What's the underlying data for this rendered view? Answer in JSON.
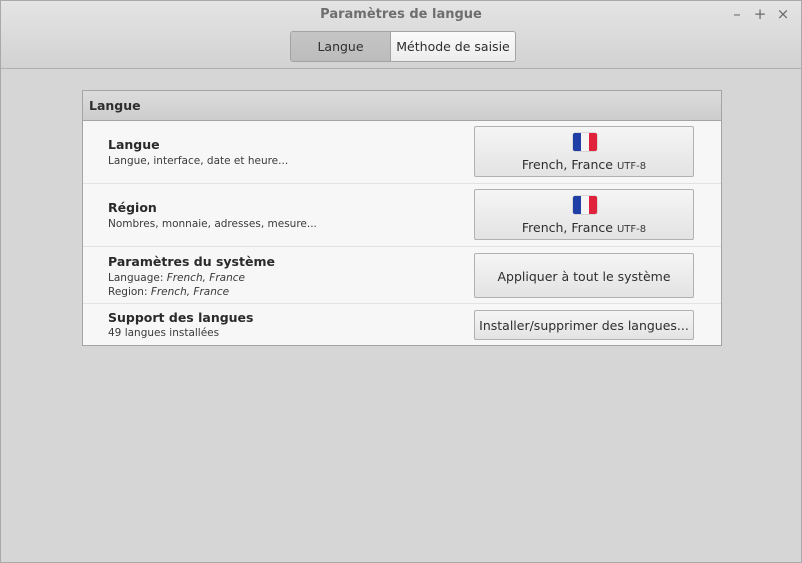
{
  "window": {
    "title": "Paramètres de langue",
    "controls": {
      "minimize": "–",
      "maximize": "+",
      "close": "×"
    }
  },
  "tabs": [
    {
      "label": "Langue",
      "active": true
    },
    {
      "label": "Méthode de saisie",
      "active": false
    }
  ],
  "panel": {
    "header": "Langue",
    "rows": [
      {
        "label": "Langue",
        "desc": "Langue, interface, date et heure...",
        "button": {
          "locale": "French, France",
          "encoding": "UTF-8",
          "icon": "flag-france-icon"
        }
      },
      {
        "label": "Région",
        "desc": "Nombres, monnaie, adresses, mesure...",
        "button": {
          "locale": "French, France",
          "encoding": "UTF-8",
          "icon": "flag-france-icon"
        }
      },
      {
        "label": "Paramètres du système",
        "desc_language_prefix": "Language: ",
        "desc_language_value": "French, France",
        "desc_region_prefix": "Region: ",
        "desc_region_value": "French, France",
        "button": {
          "label": "Appliquer à tout le système"
        }
      },
      {
        "label": "Support des langues",
        "desc": "49 langues installées",
        "button": {
          "label": "Installer/supprimer des langues..."
        }
      }
    ]
  },
  "colors": {
    "background": "#d6d6d6",
    "panel": "#f7f7f7",
    "flag_blue": "#1f3fa6",
    "flag_white": "#f5f5f5",
    "flag_red": "#e0233a"
  }
}
